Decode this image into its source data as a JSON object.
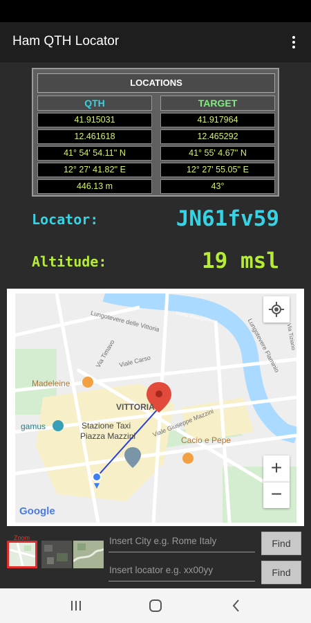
{
  "app": {
    "title": "Ham QTH Locator",
    "menu_icon": "more-vert-icon"
  },
  "locations": {
    "title": "LOCATIONS",
    "qth": {
      "header": "QTH",
      "rows": [
        "41.915031",
        "12.461618",
        "41° 54' 54.11'' N",
        "12° 27' 41.82'' E",
        "446.13 m"
      ]
    },
    "target": {
      "header": "TARGET",
      "rows": [
        "41.917964",
        "12.465292",
        "41° 55' 4.67'' N",
        "12° 27' 55.05'' E",
        "43°"
      ]
    }
  },
  "locator": {
    "label": "Locator:",
    "value": "JN61fv59"
  },
  "altitude": {
    "label": "Altitude:",
    "value": "19 msl"
  },
  "map": {
    "labels": {
      "lungotevere_vittoria": "Lungotevere delle Vittoria",
      "lungotevere_flaminio": "Lungotevere Flaminio",
      "ponte_risorgimento": "Ponte Risorgimento",
      "via_timavo": "Via Timavo",
      "viale_carso": "Viale Carso",
      "madeleine": "Madeleine",
      "vittoria": "VITTORIA",
      "gamus": "gamus",
      "stazione_taxi_1": "Stazione Taxi",
      "stazione_taxi_2": "Piazza Mazzini",
      "viale_mazzini": "Viale Giuseppe Mazzini",
      "cacio_pepe": "Cacio e Pepe",
      "google": "Google",
      "via_tiziano": "Via Tiziano"
    },
    "zoom_in": "+",
    "zoom_out": "−",
    "location_button_icon": "my-location-icon"
  },
  "map_types": {
    "zoom_label": "Zoom"
  },
  "search": {
    "city_placeholder": "Insert City e.g. Rome Italy",
    "locator_placeholder": "Insert locator e.g. xx00yy",
    "find_label": "Find"
  },
  "navbar": {
    "icons": [
      "recent-apps-icon",
      "home-icon",
      "back-icon"
    ]
  },
  "colors": {
    "qth": "#35d3e3",
    "target": "#7ef07e",
    "cell_text": "#d6f06a",
    "altitude": "#b6ec39"
  }
}
